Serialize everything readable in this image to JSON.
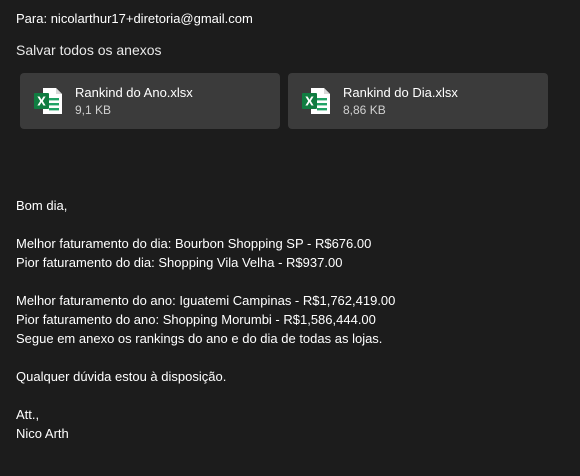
{
  "header": {
    "to_label": "Para:",
    "to_address": "nicolarthur17+diretoria@gmail.com"
  },
  "attachments_bar": {
    "save_all_label": "Salvar todos os anexos",
    "files": [
      {
        "name": "Rankind do Ano.xlsx",
        "size": "9,1 KB",
        "icon": "excel-icon"
      },
      {
        "name": "Rankind do Dia.xlsx",
        "size": "8,86 KB",
        "icon": "excel-icon"
      }
    ]
  },
  "message": {
    "greeting": "Bom dia,",
    "line_best_day": "Melhor faturamento do dia: Bourbon Shopping SP - R$676.00",
    "line_worst_day": "Pior faturamento do dia: Shopping Vila Velha - R$937.00",
    "line_best_year": "Melhor faturamento do ano: Iguatemi Campinas - R$1,762,419.00",
    "line_worst_year": "Pior faturamento do ano: Shopping Morumbi - R$1,586,444.00",
    "line_attachment_note": "Segue em anexo os rankings do ano e do dia de todas as lojas.",
    "line_availability": "Qualquer dúvida estou à disposição.",
    "signoff": "Att.,",
    "signature": "Nico Arth"
  },
  "colors": {
    "background": "#1c1c1c",
    "attachment_card": "#3b3b3b",
    "excel_green": "#21a366"
  }
}
